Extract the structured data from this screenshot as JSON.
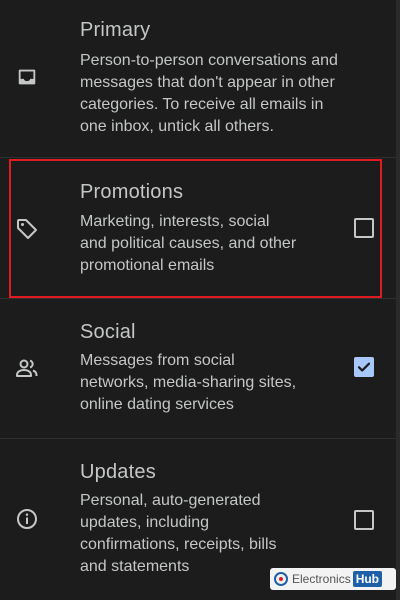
{
  "categories": [
    {
      "title": "Primary",
      "icon": "inbox-icon",
      "description_lines": [
        "Person-to-person conversations and",
        "messages that don't appear in other",
        "categories. To receive all emails in",
        "one inbox, untick all others."
      ],
      "checkbox": null
    },
    {
      "title": "Promotions",
      "icon": "tag-icon",
      "description_lines": [
        "Marketing, interests, social",
        "and political causes, and other",
        "promotional emails"
      ],
      "checkbox": "unchecked"
    },
    {
      "title": "Social",
      "icon": "people-icon",
      "description_lines": [
        "Messages from social",
        "networks, media-sharing sites,",
        "online dating services"
      ],
      "checkbox": "checked"
    },
    {
      "title": "Updates",
      "icon": "info-icon",
      "description_lines": [
        "Personal, auto-generated",
        "updates, including",
        "confirmations, receipts, bills",
        "and statements"
      ],
      "checkbox": "unchecked"
    }
  ],
  "watermark": {
    "brand": "Electronics",
    "badge": "Hub"
  },
  "colors": {
    "background": "#1c1c1d",
    "text": "#c4c7c5",
    "check_accent": "#a8c7fa",
    "highlight": "#e11b22"
  }
}
